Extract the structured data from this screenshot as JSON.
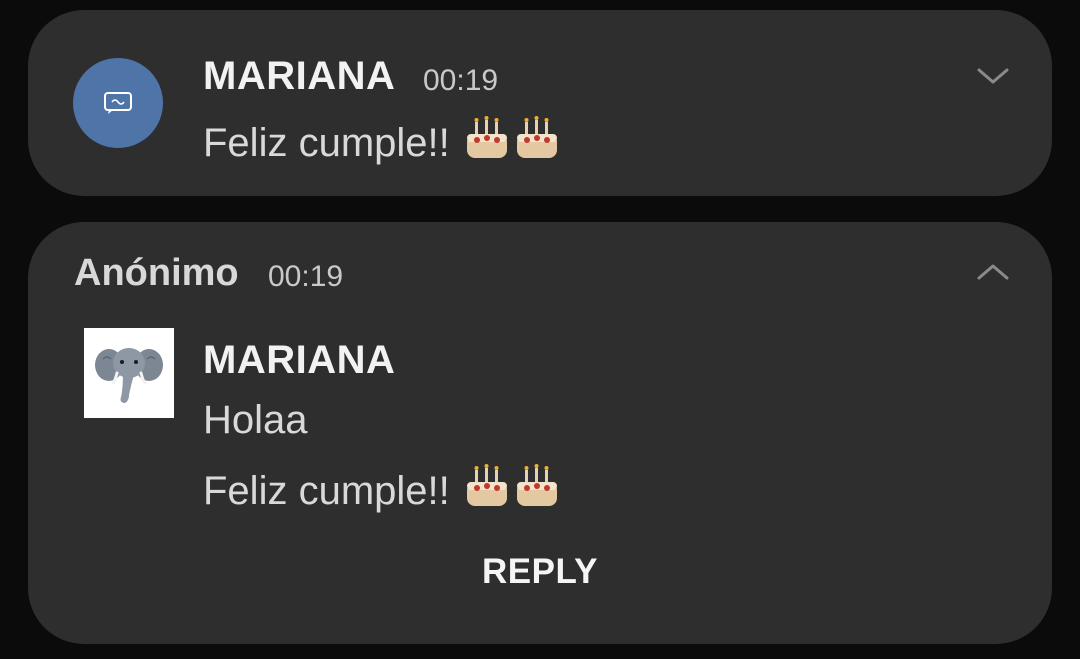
{
  "notification1": {
    "sender": "MARIANA",
    "time": "00:19",
    "message": "Feliz cumple!!",
    "emoji": "cake-emoji",
    "icon": "message-bubble-icon",
    "toggle_icon": "chevron-down-icon",
    "icon_color": "#4f74a8"
  },
  "notification2": {
    "app_name": "Anónimo",
    "time": "00:19",
    "toggle_icon": "chevron-up-icon",
    "sender": "MARIANA",
    "messages": [
      "Holaa",
      "Feliz cumple!!"
    ],
    "emoji": "cake-emoji",
    "avatar": "elephant-avatar",
    "reply_label": "REPLY"
  },
  "colors": {
    "background": "#0b0b0b",
    "card": "#2e2e2e",
    "text": "#e6e6e6"
  }
}
